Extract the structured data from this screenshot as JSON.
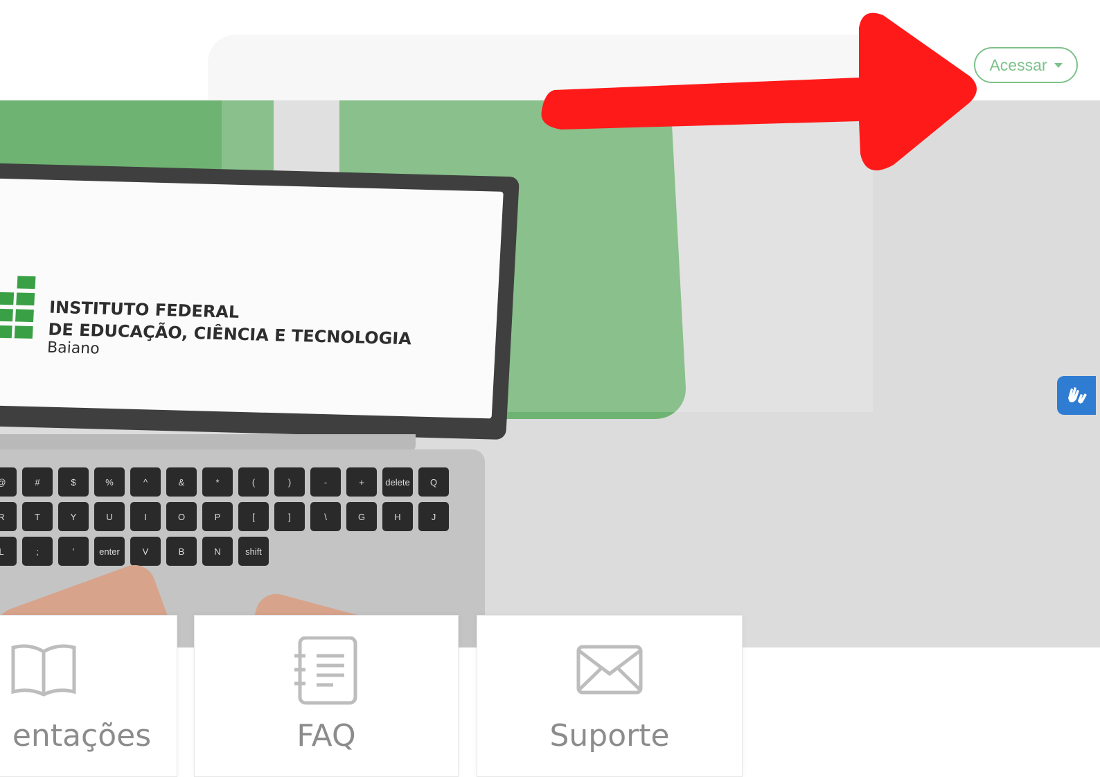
{
  "header": {
    "access_button_label": "Acessar"
  },
  "hero": {
    "institution": {
      "line1": "INSTITUTO FEDERAL",
      "line2": "DE EDUCAÇÃO, CIÊNCIA E TECNOLOGIA",
      "line3": "Baiano"
    },
    "keyboard_keys": [
      "@",
      "#",
      "$",
      "%",
      "^",
      "&",
      "*",
      "(",
      ")",
      "-",
      "+",
      "delete",
      "Q",
      "R",
      "T",
      "Y",
      "U",
      "I",
      "O",
      "P",
      "[",
      "]",
      "\\",
      "G",
      "H",
      "J",
      "L",
      ";",
      "'",
      "enter",
      "V",
      "B",
      "N",
      "shift"
    ]
  },
  "cards": [
    {
      "label": "entações",
      "icon": "book-icon"
    },
    {
      "label": "FAQ",
      "icon": "faq-list-icon"
    },
    {
      "label": "Suporte",
      "icon": "envelope-icon"
    }
  ],
  "accessibility": {
    "icon": "sign-language-hands-icon",
    "color": "#2f7cd3"
  },
  "annotation": {
    "arrow_color": "#ff1a1a",
    "icon": "arrow-right-icon"
  },
  "colors": {
    "brand_green": "#6fb372",
    "button_green": "#7cc18a"
  }
}
